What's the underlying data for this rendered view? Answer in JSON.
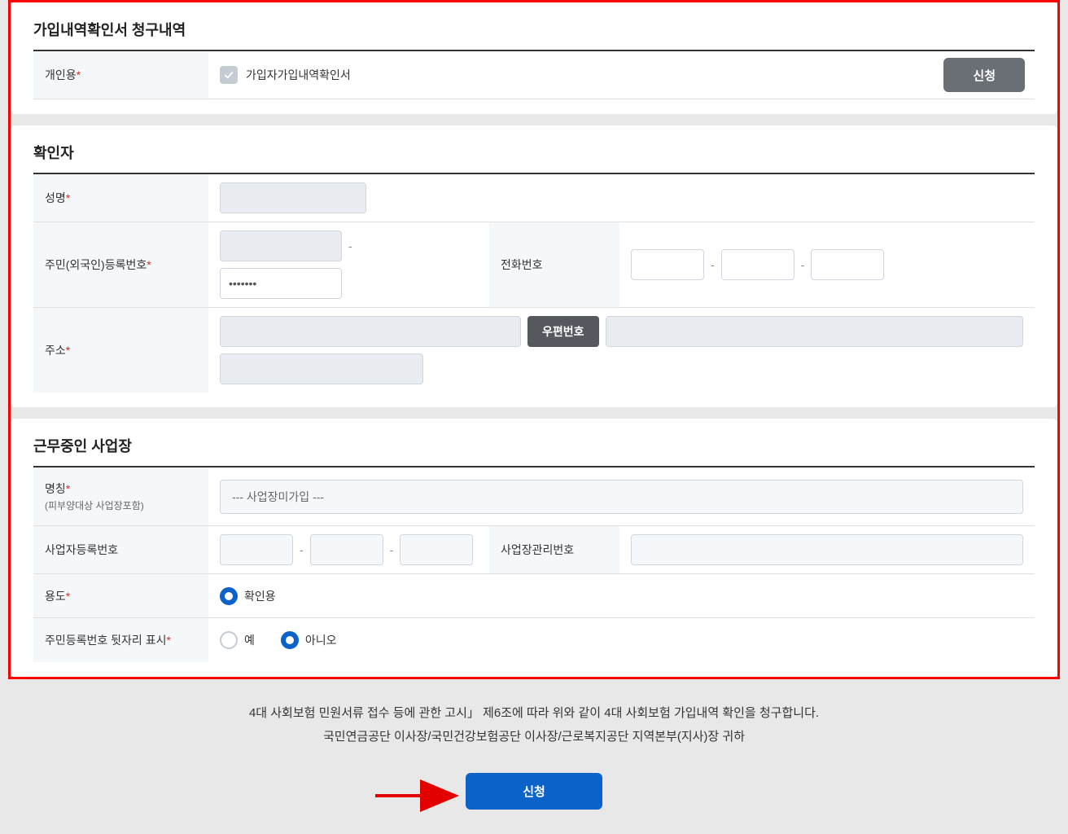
{
  "section1": {
    "title": "가입내역확인서 청구내역",
    "rows": {
      "personal": {
        "label": "개인용",
        "checkbox_label": "가입자가입내역확인서"
      }
    },
    "apply_button": "신청"
  },
  "section2": {
    "title": "확인자",
    "rows": {
      "name": {
        "label": "성명",
        "value": ""
      },
      "resident": {
        "label": "주민(외국인)등록번호",
        "p1": "",
        "p2": "·······"
      },
      "phone": {
        "label": "전화번호",
        "p1": "",
        "p2": "",
        "p3": ""
      },
      "address": {
        "label": "주소",
        "zip_button": "우편번호",
        "addr1_value": "",
        "addr2_value": "",
        "detail_value": ""
      }
    }
  },
  "section3": {
    "title": "근무중인 사업장",
    "rows": {
      "bizname": {
        "label": "명칭",
        "sublabel": "(피부양대상 사업장포함)",
        "select_value": "--- 사업장미가입 ---"
      },
      "bizreg": {
        "label": "사업자등록번호",
        "p1": "",
        "p2": "",
        "p3": ""
      },
      "mgmtno": {
        "label": "사업장관리번호",
        "value": ""
      },
      "usage": {
        "label": "용도",
        "opt1": "확인용"
      },
      "masking": {
        "label": "주민등록번호 뒷자리 표시",
        "yes": "예",
        "no": "아니오"
      }
    }
  },
  "footer": {
    "line1": "4대 사회보험 민원서류 접수 등에 관한 고시」 제6조에 따라 위와 같이 4대 사회보험 가입내역 확인을 청구합니다.",
    "line2": "국민연금공단 이사장/국민건강보험공단 이사장/근로복지공단 지역본부(지사)장 귀하",
    "submit_button": "신청"
  }
}
